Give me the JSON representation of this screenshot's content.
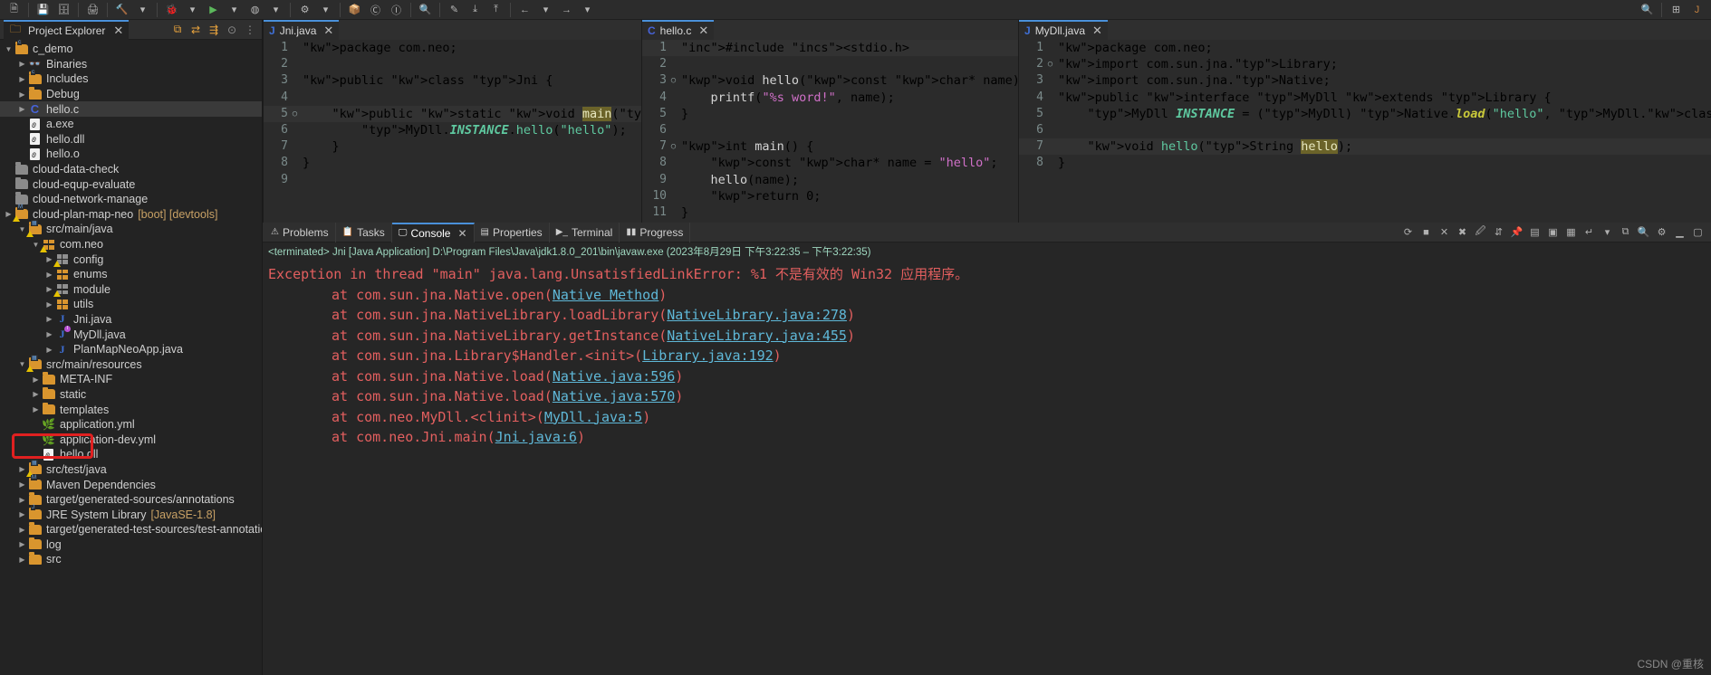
{
  "toolbar": {
    "icons": [
      "new-icon",
      "save-icon",
      "save-all-icon",
      "print-icon",
      "build-icon",
      "debug-icon",
      "run-icon",
      "external-tools-icon",
      "search-icon",
      "next-annotation-icon",
      "prev-annotation-icon",
      "back-icon",
      "forward-icon",
      "pin-icon",
      "perspective-icon",
      "java-perspective-icon"
    ]
  },
  "sidebar": {
    "tab_title": "Project Explorer",
    "close_label": "✕",
    "header_icons": [
      "collapse-all-icon",
      "link-with-editor-icon",
      "focus-active-task-icon",
      "focus-icon",
      "view-menu-icon"
    ],
    "items": [
      {
        "label": "c_demo",
        "sub": "",
        "icon": "folder-c-project",
        "depth": 0,
        "arrow": "down",
        "selected": false
      },
      {
        "label": "Binaries",
        "sub": "",
        "icon": "binaries",
        "depth": 1,
        "arrow": "right",
        "selected": false
      },
      {
        "label": "Includes",
        "sub": "",
        "icon": "folder-c-include",
        "depth": 1,
        "arrow": "right",
        "selected": false
      },
      {
        "label": "Debug",
        "sub": "",
        "icon": "folder",
        "depth": 1,
        "arrow": "right",
        "selected": false
      },
      {
        "label": "hello.c",
        "sub": "",
        "icon": "c-file",
        "depth": 1,
        "arrow": "right",
        "selected": true
      },
      {
        "label": "a.exe",
        "sub": "",
        "icon": "binary-file",
        "depth": 1,
        "arrow": "",
        "selected": false
      },
      {
        "label": "hello.dll",
        "sub": "",
        "icon": "binary-file",
        "depth": 1,
        "arrow": "",
        "selected": false
      },
      {
        "label": "hello.o",
        "sub": "",
        "icon": "binary-file",
        "depth": 1,
        "arrow": "",
        "selected": false
      },
      {
        "label": "cloud-data-check",
        "sub": "",
        "icon": "folder-grey",
        "depth": 0,
        "arrow": "",
        "selected": false
      },
      {
        "label": "cloud-equp-evaluate",
        "sub": "",
        "icon": "folder-grey",
        "depth": 0,
        "arrow": "",
        "selected": false
      },
      {
        "label": "cloud-network-manage",
        "sub": "",
        "icon": "folder-grey",
        "depth": 0,
        "arrow": "",
        "selected": false
      },
      {
        "label": "cloud-plan-map-neo",
        "sub": "[boot] [devtools]",
        "icon": "maven-project",
        "depth": 0,
        "arrow": "right",
        "selected": false
      },
      {
        "label": "src/main/java",
        "sub": "",
        "icon": "source-folder",
        "depth": 1,
        "arrow": "down",
        "selected": false
      },
      {
        "label": "com.neo",
        "sub": "",
        "icon": "package-warn",
        "depth": 2,
        "arrow": "down",
        "selected": false
      },
      {
        "label": "config",
        "sub": "",
        "icon": "package-grey-warn",
        "depth": 3,
        "arrow": "right",
        "selected": false
      },
      {
        "label": "enums",
        "sub": "",
        "icon": "package",
        "depth": 3,
        "arrow": "right",
        "selected": false
      },
      {
        "label": "module",
        "sub": "",
        "icon": "package-grey-warn",
        "depth": 3,
        "arrow": "right",
        "selected": false
      },
      {
        "label": "utils",
        "sub": "",
        "icon": "package",
        "depth": 3,
        "arrow": "right",
        "selected": false
      },
      {
        "label": "Jni.java",
        "sub": "",
        "icon": "java-file",
        "depth": 3,
        "arrow": "right",
        "selected": false
      },
      {
        "label": "MyDll.java",
        "sub": "",
        "icon": "java-interface",
        "depth": 3,
        "arrow": "right",
        "selected": false
      },
      {
        "label": "PlanMapNeoApp.java",
        "sub": "",
        "icon": "java-file",
        "depth": 3,
        "arrow": "right",
        "selected": false
      },
      {
        "label": "src/main/resources",
        "sub": "",
        "icon": "source-folder",
        "depth": 1,
        "arrow": "down",
        "selected": false
      },
      {
        "label": "META-INF",
        "sub": "",
        "icon": "folder",
        "depth": 2,
        "arrow": "right",
        "selected": false
      },
      {
        "label": "static",
        "sub": "",
        "icon": "folder",
        "depth": 2,
        "arrow": "right",
        "selected": false
      },
      {
        "label": "templates",
        "sub": "",
        "icon": "folder",
        "depth": 2,
        "arrow": "right",
        "selected": false
      },
      {
        "label": "application.yml",
        "sub": "",
        "icon": "yml-file",
        "depth": 2,
        "arrow": "",
        "selected": false
      },
      {
        "label": "application-dev.yml",
        "sub": "",
        "icon": "yml-file",
        "depth": 2,
        "arrow": "",
        "selected": false
      },
      {
        "label": "hello.dll",
        "sub": "",
        "icon": "binary-file",
        "depth": 2,
        "arrow": "",
        "selected": false
      },
      {
        "label": "src/test/java",
        "sub": "",
        "icon": "source-folder",
        "depth": 1,
        "arrow": "right",
        "selected": false
      },
      {
        "label": "Maven Dependencies",
        "sub": "",
        "icon": "maven-deps",
        "depth": 1,
        "arrow": "right",
        "selected": false
      },
      {
        "label": "target/generated-sources/annotations",
        "sub": "",
        "icon": "folder",
        "depth": 1,
        "arrow": "right",
        "selected": false
      },
      {
        "label": "JRE System Library",
        "sub": "[JavaSE-1.8]",
        "icon": "jre-library",
        "depth": 1,
        "arrow": "right",
        "selected": false
      },
      {
        "label": "target/generated-test-sources/test-annotations",
        "sub": "",
        "icon": "folder",
        "depth": 1,
        "arrow": "right",
        "selected": false
      },
      {
        "label": "log",
        "sub": "",
        "icon": "folder",
        "depth": 1,
        "arrow": "right",
        "selected": false
      },
      {
        "label": "src",
        "sub": "",
        "icon": "folder",
        "depth": 1,
        "arrow": "right",
        "selected": false
      }
    ],
    "highlight": "hello.dll"
  },
  "editors": [
    {
      "tab_label": "Jni.java",
      "icon": "java-file-icon",
      "close": "✕",
      "lines": [
        {
          "n": "1",
          "fold": "",
          "hl": false
        },
        {
          "n": "2",
          "fold": "",
          "hl": false
        },
        {
          "n": "3",
          "fold": "",
          "hl": false
        },
        {
          "n": "4",
          "fold": "",
          "hl": false
        },
        {
          "n": "5",
          "fold": "○",
          "hl": true
        },
        {
          "n": "6",
          "fold": "",
          "hl": false
        },
        {
          "n": "7",
          "fold": "",
          "hl": false
        },
        {
          "n": "8",
          "fold": "",
          "hl": false
        },
        {
          "n": "9",
          "fold": "",
          "hl": false
        }
      ],
      "text": [
        "package com.neo;",
        "",
        "public class Jni {",
        "",
        "    public static void main(String[] a",
        "        MyDll.INSTANCE.hello(\"hello\");",
        "    }",
        "}",
        ""
      ]
    },
    {
      "tab_label": "hello.c",
      "icon": "c-file-icon",
      "close": "✕",
      "lines": [
        {
          "n": "1",
          "fold": "",
          "hl": true
        },
        {
          "n": "2",
          "fold": "",
          "hl": false
        },
        {
          "n": "3",
          "fold": "○",
          "hl": false
        },
        {
          "n": "4",
          "fold": "",
          "hl": false
        },
        {
          "n": "5",
          "fold": "",
          "hl": false
        },
        {
          "n": "6",
          "fold": "",
          "hl": false
        },
        {
          "n": "7",
          "fold": "○",
          "hl": false
        },
        {
          "n": "8",
          "fold": "",
          "hl": false
        },
        {
          "n": "9",
          "fold": "",
          "hl": false
        },
        {
          "n": "10",
          "fold": "",
          "hl": false
        },
        {
          "n": "11",
          "fold": "",
          "hl": false
        }
      ],
      "text": [
        "#include <stdio.h>",
        "",
        "void hello(const char* name) {",
        "    printf(\"%s word!\", name);",
        "}",
        "",
        "int main() {",
        "    const char* name = \"hello\";",
        "    hello(name);",
        "    return 0;",
        "}"
      ]
    },
    {
      "tab_label": "MyDll.java",
      "icon": "java-interface-icon",
      "close": "✕",
      "lines": [
        {
          "n": "1",
          "fold": "",
          "hl": false
        },
        {
          "n": "2",
          "fold": "○",
          "hl": false
        },
        {
          "n": "3",
          "fold": "",
          "hl": false
        },
        {
          "n": "4",
          "fold": "",
          "hl": false
        },
        {
          "n": "5",
          "fold": "",
          "hl": false
        },
        {
          "n": "6",
          "fold": "",
          "hl": false
        },
        {
          "n": "7",
          "fold": "",
          "hl": true
        },
        {
          "n": "8",
          "fold": "",
          "hl": false
        }
      ],
      "text": [
        "package com.neo;",
        "import com.sun.jna.Library;",
        "import com.sun.jna.Native;",
        "public interface MyDll extends Library {",
        "    MyDll INSTANCE = (MyDll) Native.load(\"hello\", MyDll.class);",
        "",
        "    void hello(String hello);",
        "}"
      ]
    }
  ],
  "bottom_panel": {
    "tabs": [
      {
        "label": "Problems",
        "icon": "problems-icon",
        "active": false,
        "closable": false
      },
      {
        "label": "Tasks",
        "icon": "tasks-icon",
        "active": false,
        "closable": false
      },
      {
        "label": "Console",
        "icon": "console-icon",
        "active": true,
        "closable": true
      },
      {
        "label": "Properties",
        "icon": "properties-icon",
        "active": false,
        "closable": false
      },
      {
        "label": "Terminal",
        "icon": "terminal-icon",
        "active": false,
        "closable": false
      },
      {
        "label": "Progress",
        "icon": "progress-icon",
        "active": false,
        "closable": false
      }
    ],
    "close_label": "✕",
    "toolbar_icons": [
      "refresh-icon",
      "terminate-icon",
      "remove-launch-icon",
      "remove-all-terminated-icon",
      "clear-console-icon",
      "scroll-lock-icon",
      "pin-console-icon",
      "display-selected-console-icon",
      "open-console-icon",
      "new-console-view-icon",
      "word-wrap-icon",
      "menu-icon",
      "copy-icon",
      "find-icon",
      "preferences-icon",
      "minimize-icon",
      "maximize-icon"
    ],
    "terminated_line": "<terminated> Jni [Java Application] D:\\Program Files\\Java\\jdk1.8.0_201\\bin\\javaw.exe  (2023年8月29日 下午3:22:35 – 下午3:22:35)",
    "console_output": [
      {
        "indent": false,
        "pre": "Exception in thread \"main\" java.lang.UnsatisfiedLinkError: %1 不是有效的 Win32 应用程序。",
        "link": "",
        "post": ""
      },
      {
        "indent": false,
        "pre": "",
        "link": "",
        "post": ""
      },
      {
        "indent": true,
        "pre": "at com.sun.jna.Native.open(",
        "link": "Native Method",
        "post": ")"
      },
      {
        "indent": true,
        "pre": "at com.sun.jna.NativeLibrary.loadLibrary(",
        "link": "NativeLibrary.java:278",
        "post": ")"
      },
      {
        "indent": true,
        "pre": "at com.sun.jna.NativeLibrary.getInstance(",
        "link": "NativeLibrary.java:455",
        "post": ")"
      },
      {
        "indent": true,
        "pre": "at com.sun.jna.Library$Handler.<init>(",
        "link": "Library.java:192",
        "post": ")"
      },
      {
        "indent": true,
        "pre": "at com.sun.jna.Native.load(",
        "link": "Native.java:596",
        "post": ")"
      },
      {
        "indent": true,
        "pre": "at com.sun.jna.Native.load(",
        "link": "Native.java:570",
        "post": ")"
      },
      {
        "indent": true,
        "pre": "at com.neo.MyDll.<clinit>(",
        "link": "MyDll.java:5",
        "post": ")"
      },
      {
        "indent": true,
        "pre": "at com.neo.Jni.main(",
        "link": "Jni.java:6",
        "post": ")"
      }
    ]
  },
  "watermark": "CSDN @重核",
  "colors": {
    "accent": "#4a90d9",
    "error": "#e35f5f",
    "link": "#5fb8d8",
    "folder": "#d9952e",
    "highlight_box": "#e02020",
    "console_info": "#9fd8c0"
  }
}
